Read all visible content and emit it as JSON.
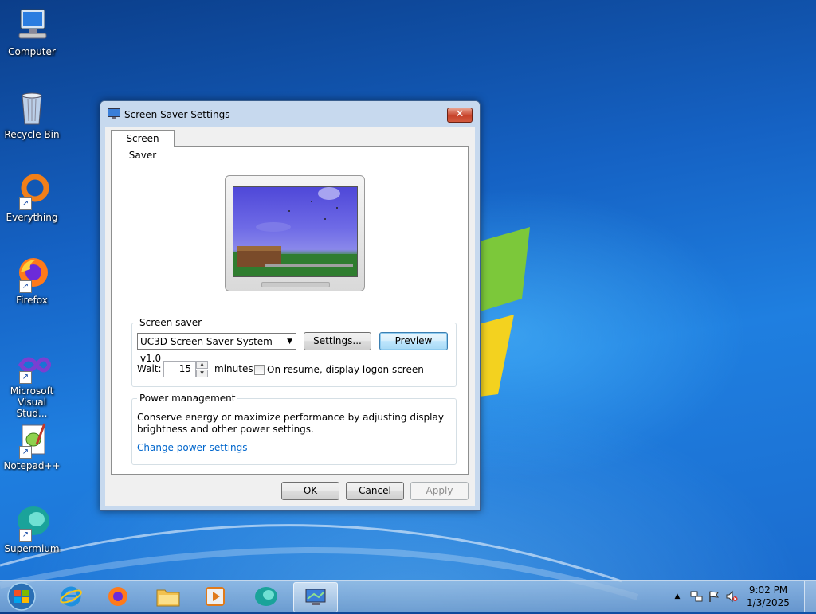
{
  "desktop": {
    "icons": [
      {
        "label": "Computer",
        "icon": "computer-icon"
      },
      {
        "label": "Recycle Bin",
        "icon": "recycle-bin-icon"
      },
      {
        "label": "Everything",
        "icon": "everything-icon"
      },
      {
        "label": "Firefox",
        "icon": "firefox-icon"
      },
      {
        "label": "Microsoft Visual Stud...",
        "icon": "visual-studio-icon"
      },
      {
        "label": "Notepad++",
        "icon": "notepadpp-icon"
      },
      {
        "label": "Supermium",
        "icon": "supermium-icon"
      }
    ]
  },
  "dialog": {
    "title": "Screen Saver Settings",
    "close_label": "✕",
    "tab_label": "Screen Saver",
    "screen_saver_group": {
      "label": "Screen saver",
      "selected": "UC3D Screen Saver System v1.0",
      "settings_button": "Settings...",
      "preview_button": "Preview",
      "wait_label": "Wait:",
      "wait_value": "15",
      "minutes_label": "minutes",
      "resume_label": "On resume, display logon screen",
      "resume_checked": false
    },
    "power_group": {
      "label": "Power management",
      "description_line1": "Conserve energy or maximize performance by adjusting display",
      "description_line2": "brightness and other power settings.",
      "link": "Change power settings"
    },
    "buttons": {
      "ok": "OK",
      "cancel": "Cancel",
      "apply": "Apply"
    }
  },
  "taskbar": {
    "items": [
      "start-orb",
      "internet-explorer",
      "firefox",
      "file-explorer",
      "media-player",
      "supermium",
      "screen-saver-settings"
    ],
    "active_item": "screen-saver-settings",
    "clock_time": "9:02 PM",
    "clock_date": "1/3/2025"
  },
  "colors": {
    "desktop_blue": "#1f7fe0",
    "link_blue": "#0066cc",
    "focused_button": "#bee6fd",
    "close_red": "#c7432a"
  }
}
